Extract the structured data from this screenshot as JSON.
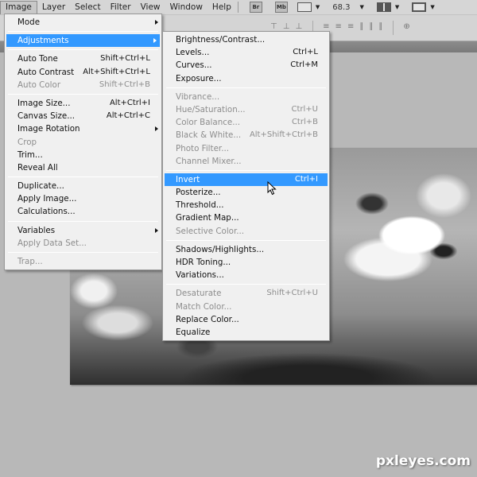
{
  "menubar": {
    "items": [
      "Image",
      "Layer",
      "Select",
      "Filter",
      "View",
      "Window",
      "Help"
    ],
    "open_item": "Image",
    "app_buttons": [
      {
        "name": "bridge-button",
        "label": "Br"
      },
      {
        "name": "mini-bridge-button",
        "label": "Mb"
      }
    ],
    "zoom_value": "68.3"
  },
  "image_menu": {
    "groups": [
      [
        {
          "label": "Mode",
          "shortcut": "",
          "submenu": true,
          "disabled": false
        }
      ],
      [
        {
          "label": "Adjustments",
          "shortcut": "",
          "submenu": true,
          "disabled": false,
          "highlighted": true
        }
      ],
      [
        {
          "label": "Auto Tone",
          "shortcut": "Shift+Ctrl+L",
          "disabled": false
        },
        {
          "label": "Auto Contrast",
          "shortcut": "Alt+Shift+Ctrl+L",
          "disabled": false
        },
        {
          "label": "Auto Color",
          "shortcut": "Shift+Ctrl+B",
          "disabled": true
        }
      ],
      [
        {
          "label": "Image Size...",
          "shortcut": "Alt+Ctrl+I",
          "disabled": false
        },
        {
          "label": "Canvas Size...",
          "shortcut": "Alt+Ctrl+C",
          "disabled": false
        },
        {
          "label": "Image Rotation",
          "shortcut": "",
          "submenu": true,
          "disabled": false
        },
        {
          "label": "Crop",
          "shortcut": "",
          "disabled": true
        },
        {
          "label": "Trim...",
          "shortcut": "",
          "disabled": false
        },
        {
          "label": "Reveal All",
          "shortcut": "",
          "disabled": false
        }
      ],
      [
        {
          "label": "Duplicate...",
          "shortcut": "",
          "disabled": false
        },
        {
          "label": "Apply Image...",
          "shortcut": "",
          "disabled": false
        },
        {
          "label": "Calculations...",
          "shortcut": "",
          "disabled": false
        }
      ],
      [
        {
          "label": "Variables",
          "shortcut": "",
          "submenu": true,
          "disabled": false
        },
        {
          "label": "Apply Data Set...",
          "shortcut": "",
          "disabled": true
        }
      ],
      [
        {
          "label": "Trap...",
          "shortcut": "",
          "disabled": true
        }
      ]
    ]
  },
  "adjustments_menu": {
    "groups": [
      [
        {
          "label": "Brightness/Contrast...",
          "shortcut": "",
          "disabled": false
        },
        {
          "label": "Levels...",
          "shortcut": "Ctrl+L",
          "disabled": false
        },
        {
          "label": "Curves...",
          "shortcut": "Ctrl+M",
          "disabled": false
        },
        {
          "label": "Exposure...",
          "shortcut": "",
          "disabled": false
        }
      ],
      [
        {
          "label": "Vibrance...",
          "shortcut": "",
          "disabled": true
        },
        {
          "label": "Hue/Saturation...",
          "shortcut": "Ctrl+U",
          "disabled": true
        },
        {
          "label": "Color Balance...",
          "shortcut": "Ctrl+B",
          "disabled": true
        },
        {
          "label": "Black & White...",
          "shortcut": "Alt+Shift+Ctrl+B",
          "disabled": true
        },
        {
          "label": "Photo Filter...",
          "shortcut": "",
          "disabled": true
        },
        {
          "label": "Channel Mixer...",
          "shortcut": "",
          "disabled": true
        }
      ],
      [
        {
          "label": "Invert",
          "shortcut": "Ctrl+I",
          "disabled": false,
          "highlighted": true
        },
        {
          "label": "Posterize...",
          "shortcut": "",
          "disabled": false
        },
        {
          "label": "Threshold...",
          "shortcut": "",
          "disabled": false
        },
        {
          "label": "Gradient Map...",
          "shortcut": "",
          "disabled": false
        },
        {
          "label": "Selective Color...",
          "shortcut": "",
          "disabled": true
        }
      ],
      [
        {
          "label": "Shadows/Highlights...",
          "shortcut": "",
          "disabled": false
        },
        {
          "label": "HDR Toning...",
          "shortcut": "",
          "disabled": false
        },
        {
          "label": "Variations...",
          "shortcut": "",
          "disabled": false
        }
      ],
      [
        {
          "label": "Desaturate",
          "shortcut": "Shift+Ctrl+U",
          "disabled": true
        },
        {
          "label": "Match Color...",
          "shortcut": "",
          "disabled": true
        },
        {
          "label": "Replace Color...",
          "shortcut": "",
          "disabled": false
        },
        {
          "label": "Equalize",
          "shortcut": "",
          "disabled": false
        }
      ]
    ]
  },
  "colors": {
    "highlight": "#3399ff",
    "menu_bg": "#f0f0f0",
    "disabled_text": "#8d8d8d"
  },
  "watermark": "pxleyes.com"
}
